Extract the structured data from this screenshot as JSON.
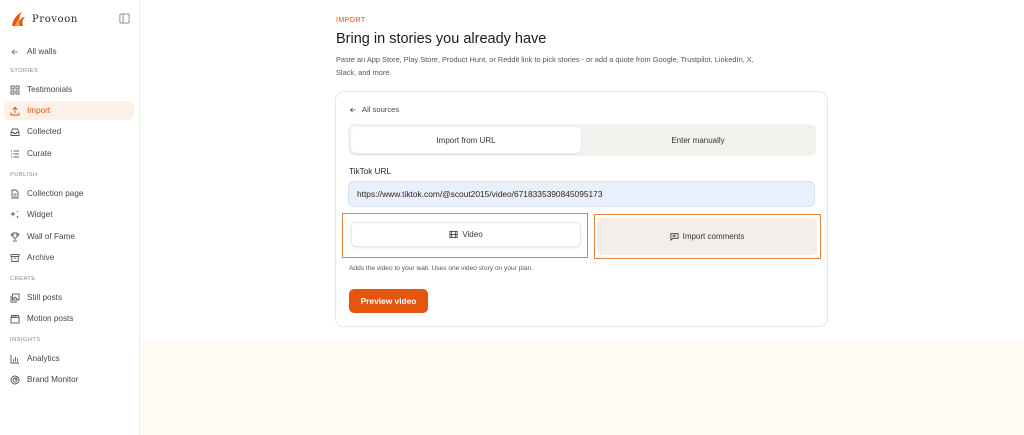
{
  "brand": {
    "name": "Provoon",
    "accent": "#E4560E"
  },
  "sidebar": {
    "back_label": "All walls",
    "sections": {
      "stories": "STORIES",
      "publish": "PUBLISH",
      "create": "CREATE",
      "insights": "INSIGHTS"
    },
    "items": {
      "testimonials": "Testimonials",
      "import": "Import",
      "collected": "Collected",
      "curate": "Curate",
      "collection_page": "Collection page",
      "widget": "Widget",
      "wall_of_fame": "Wall of Fame",
      "archive": "Archive",
      "still_posts": "Still posts",
      "motion_posts": "Motion posts",
      "analytics": "Analytics",
      "brand_monitor": "Brand Monitor"
    },
    "active_item": "Import"
  },
  "page": {
    "eyebrow": "IMPORT",
    "title": "Bring in stories you already have",
    "subtitle": "Paste an App Store, Play Store, Product Hunt, or Reddit link to pick stories - or add a quote from Google, Trustpilot, LinkedIn, X, Slack, and more."
  },
  "card": {
    "back_label": "All sources",
    "tabs": {
      "url": "Import from URL",
      "manual": "Enter manually",
      "selected": "Import from URL"
    },
    "url_label": "TikTok URL",
    "url_value": "https://www.tiktok.com/@scout2015/video/6718335390845095173",
    "modes": {
      "video": "Video",
      "comments": "Import comments",
      "selected": "Video"
    },
    "hint": "Adds the video to your wall. Uses one video story on your plan.",
    "primary_button": "Preview video"
  }
}
